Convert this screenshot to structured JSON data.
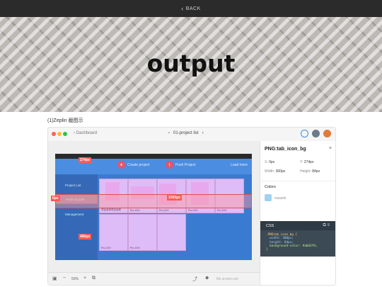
{
  "nav": {
    "back_label": "BACK",
    "back_icon": "chevron-left-icon"
  },
  "hero": {
    "title": "output"
  },
  "caption": "(1)Zeplin 截图示",
  "zeplin": {
    "breadcrumb": "Dashboard",
    "project": "01-project list",
    "canvas_measurements": [
      "274px",
      "0px",
      "1000px",
      "400px"
    ],
    "app_buttons": [
      "Create project",
      "Push Project"
    ],
    "bar_right_label": "Load more",
    "sidebar_items": [
      "Project List",
      "Push records",
      "Management"
    ],
    "card_labels": [
      "项目名称项目名称",
      "Pro-XXX",
      "Pro-XXX",
      "Pro-XXX",
      "Pro-XXX",
      "Pro-XXX",
      "Pro-XXX"
    ],
    "zoom": "50%",
    "bottom_placeholder": "No screen set",
    "panel": {
      "title": "PNG:tab_icon_bg",
      "close": "×",
      "x_label": "X:",
      "x_value": "0px",
      "y_label": "Y:",
      "y_value": "274px",
      "width_label": "Width:",
      "width_value": "300px",
      "height_label": "Height:",
      "height_value": "84px",
      "colors_title": "Colors",
      "color_hex": "#a0d2f0",
      "css_title": "CSS",
      "css_lines": [
        ".PNGtab_icon_bg {",
        "  width: 300px;",
        "  height: 84px;",
        "  background-color: #a0d2f0;",
        "}"
      ]
    }
  },
  "colors": {
    "topbar": "#2b2b2b",
    "canvas_blue": "#3a7bd2",
    "overlay_red": "#e05050",
    "card_pink": "#fcc8ff",
    "swatch": "#a0d2f0"
  }
}
